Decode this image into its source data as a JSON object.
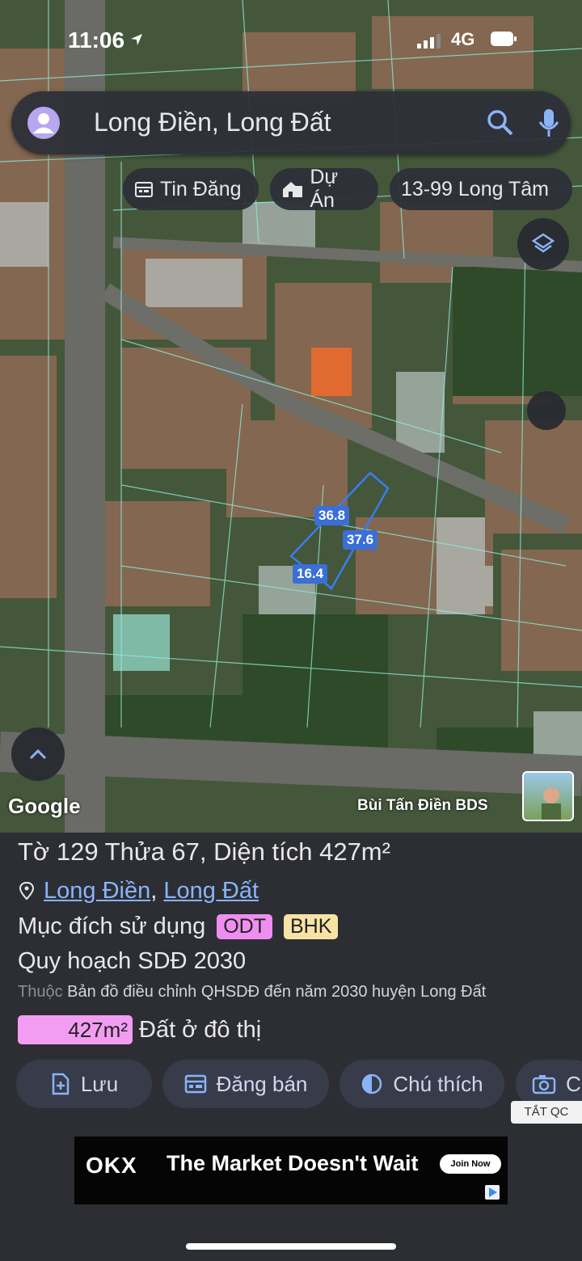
{
  "status_bar": {
    "time": "11:06",
    "network": "4G"
  },
  "search": {
    "query": "Long Điền, Long Đất"
  },
  "chips": [
    {
      "label": "Tin Đăng",
      "icon": "calendar-icon"
    },
    {
      "label": "Dự Án",
      "icon": "house-icon"
    },
    {
      "label": "13-99 Long Tâm",
      "icon": ""
    }
  ],
  "map": {
    "measurements": [
      "36.8",
      "37.6",
      "16.4"
    ],
    "google_label": "Google",
    "credit": "Bùi Tấn Điền BDS"
  },
  "parcel": {
    "title": "Tờ 129 Thửa 67, Diện tích 427m²",
    "location": {
      "district": "Long Điền",
      "separator": ", ",
      "province": "Long Đất"
    },
    "purpose_label": "Mục đích sử dụng",
    "purpose_tags": [
      {
        "code": "ODT",
        "color": "#ef8ef0"
      },
      {
        "code": "BHK",
        "color": "#f7e3a4"
      }
    ],
    "plan_label": "Quy hoạch SDĐ 2030",
    "belongs_prefix": "Thuộc",
    "belongs_text": "Bản đồ điều chỉnh QHSDĐ đến năm 2030 huyện Long Đất",
    "area_value": "427m²",
    "area_type": "Đất ở đô thị",
    "area_fill": 1.0
  },
  "actions": [
    {
      "label": "Lưu",
      "icon": "save-doc-icon"
    },
    {
      "label": "Đăng bán",
      "icon": "calendar-icon"
    },
    {
      "label": "Chú thích",
      "icon": "contrast-icon"
    },
    {
      "label": "C",
      "icon": "camera-icon"
    }
  ],
  "ad_toggle": "TẮT QC",
  "ad": {
    "brand": "OKX",
    "headline": "The Market Doesn't Wait",
    "cta": "Join Now"
  },
  "colors": {
    "accent": "#8ab4f8",
    "odt": "#ef8ef0",
    "bhk": "#f7e3a4",
    "area": "#f29df2"
  }
}
